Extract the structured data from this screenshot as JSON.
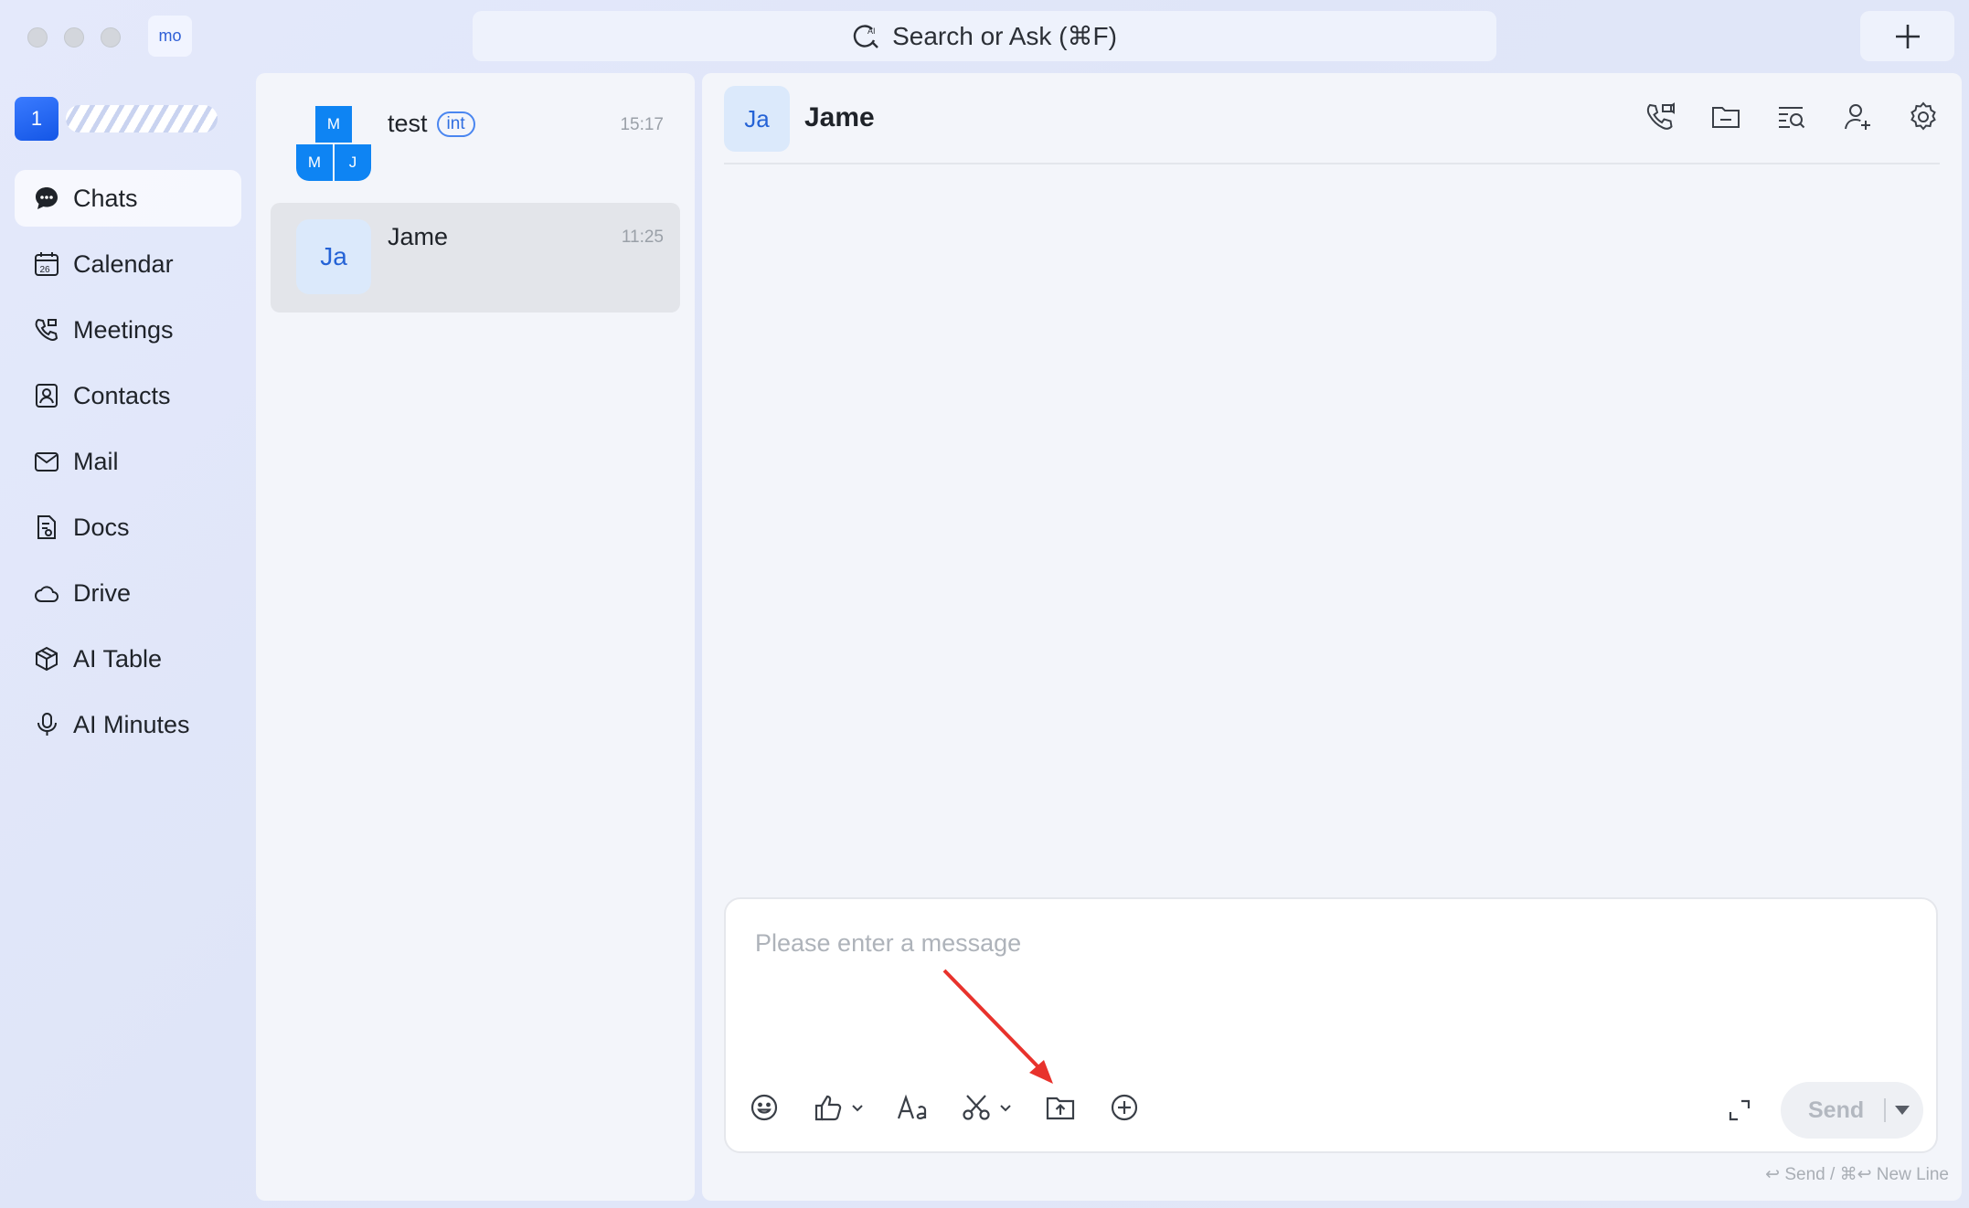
{
  "titlebar": {
    "workspace_badge": "mo",
    "search_placeholder": "Search or Ask  (⌘F)"
  },
  "sidebar": {
    "org_badge": "1",
    "items": [
      {
        "label": "Chats",
        "icon": "chat-bubble-icon",
        "active": true
      },
      {
        "label": "Calendar",
        "icon": "calendar-icon"
      },
      {
        "label": "Meetings",
        "icon": "meetings-phone-icon"
      },
      {
        "label": "Contacts",
        "icon": "contacts-icon"
      },
      {
        "label": "Mail",
        "icon": "mail-icon"
      },
      {
        "label": "Docs",
        "icon": "docs-icon"
      },
      {
        "label": "Drive",
        "icon": "cloud-drive-icon"
      },
      {
        "label": "AI Table",
        "icon": "ai-table-icon"
      },
      {
        "label": "AI Minutes",
        "icon": "ai-minutes-icon"
      }
    ],
    "calendar_day": "26"
  },
  "chat_list": [
    {
      "name": "test",
      "tag": "int",
      "time": "15:17",
      "avatar_cells": [
        "M",
        "M",
        "J"
      ]
    },
    {
      "name": "Jame",
      "time": "11:25",
      "avatar": "Ja",
      "selected": true
    }
  ],
  "conversation": {
    "avatar": "Ja",
    "title": "Jame",
    "header_icons": [
      "call-icon",
      "folder-icon",
      "search-history-icon",
      "add-member-icon",
      "settings-icon"
    ]
  },
  "composer": {
    "placeholder": "Please enter a message",
    "tools": [
      "emoji-icon",
      "thumbs-up-icon",
      "text-format-icon",
      "scissors-icon",
      "upload-file-icon",
      "add-circle-icon"
    ],
    "send_label": "Send",
    "hint": "↩ Send / ⌘↩ New Line"
  },
  "annotation": {
    "color": "#e8322c",
    "points_to": "upload-file-icon"
  }
}
